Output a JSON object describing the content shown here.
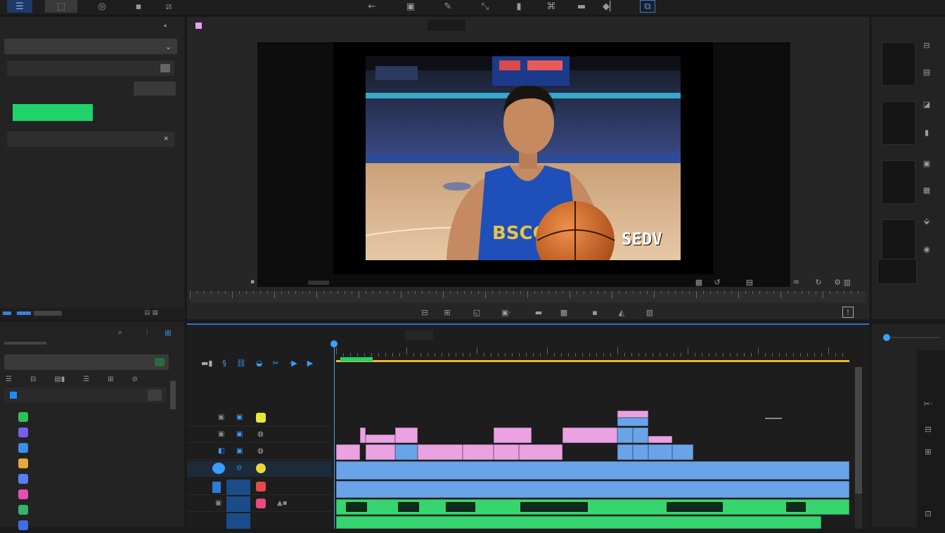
{
  "colors": {
    "accent_green": "#1ed36b",
    "accent_blue": "#1a8cff",
    "playhead_blue": "#3aa0ff",
    "clip_pink": "#eaa2e3",
    "clip_blue": "#6aa4e8",
    "clip_green": "#37d56f",
    "orange_bar": "#f2b42a"
  },
  "toolbar": {
    "icons": [
      "menu-icon",
      "cursor-icon",
      "record-icon",
      "undo-icon",
      "redo-icon",
      "crop-icon",
      "brush-icon",
      "link-icon",
      "split-icon",
      "pen-icon",
      "transition-icon",
      "marker-icon",
      "export-icon"
    ]
  },
  "left_panel": {
    "title": "",
    "dropdown_value": "",
    "search_value": "",
    "option_label": "",
    "option_button": "",
    "primary_button": "",
    "section_label": ""
  },
  "media_panel": {
    "title": "",
    "search_value": "",
    "group_label": "",
    "items": [
      {
        "icon_color": "#2fbf5b",
        "label": ""
      },
      {
        "icon_color": "#7b5cf0",
        "label": ""
      },
      {
        "icon_color": "#3a8ee8",
        "label": ""
      },
      {
        "icon_color": "#e8a83a",
        "label": ""
      },
      {
        "icon_color": "#5a7df0",
        "label": ""
      },
      {
        "icon_color": "#e44fb2",
        "label": ""
      },
      {
        "icon_color": "#35b36e",
        "label": ""
      },
      {
        "icon_color": "#3a6fe8",
        "label": ""
      }
    ]
  },
  "viewer": {
    "tab_label": "",
    "overlay_text": "SEDV",
    "timecode_label": "",
    "time_red": ""
  },
  "right_panel": {
    "footer_label": ""
  },
  "timeline": {
    "header_label": "",
    "sub_label": "",
    "track_label": "",
    "playhead_pct": 0
  }
}
